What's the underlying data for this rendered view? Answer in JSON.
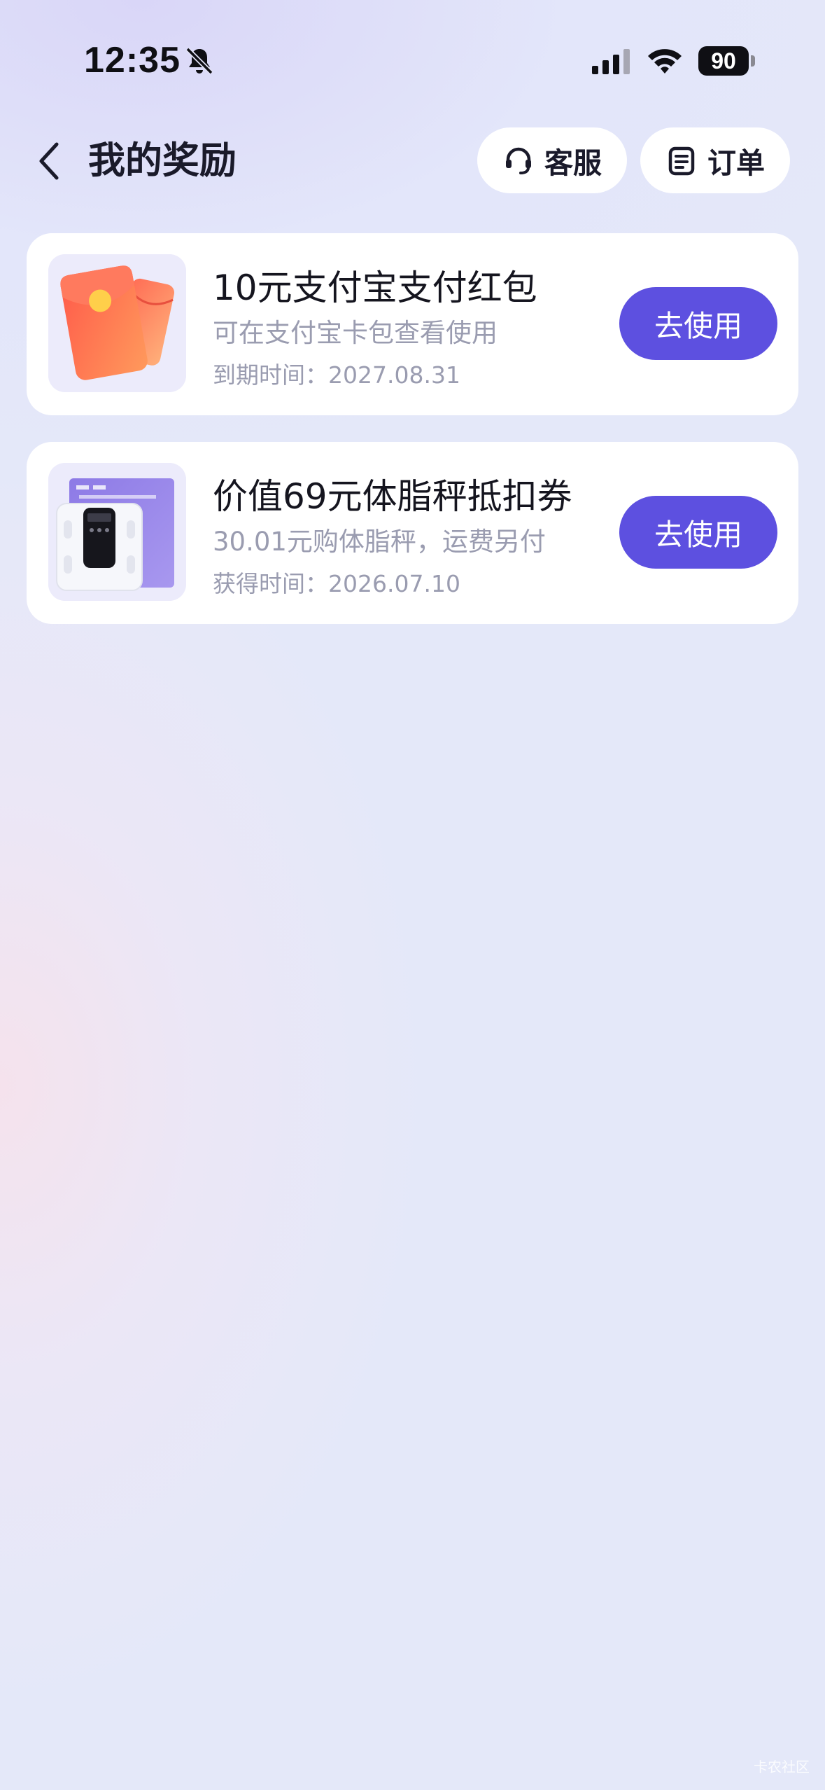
{
  "status_bar": {
    "time": "12:35",
    "battery": "90",
    "icons": [
      "bell-slash-icon",
      "cellular-signal-icon",
      "wifi-icon",
      "battery-icon"
    ]
  },
  "header": {
    "back_icon": "chevron-left-icon",
    "title": "我的奖励",
    "service_label": "客服",
    "service_icon": "headset-icon",
    "orders_label": "订单",
    "orders_icon": "clipboard-icon"
  },
  "rewards": [
    {
      "title": "10元支付宝支付红包",
      "description": "可在支付宝卡包查看使用",
      "date": "到期时间：2027.08.31",
      "button": "去使用",
      "image": "red-envelope-image"
    },
    {
      "title": "价值69元体脂秤抵扣券",
      "description": "30.01元购体脂秤，运费另付",
      "date": "获得时间：2026.07.10",
      "button": "去使用",
      "image": "body-fat-scale-image"
    }
  ],
  "colors": {
    "accent": "#5d50e0",
    "card_background": "#ffffff",
    "secondary_text": "#9a9cb0"
  },
  "watermark": "卡农社区"
}
